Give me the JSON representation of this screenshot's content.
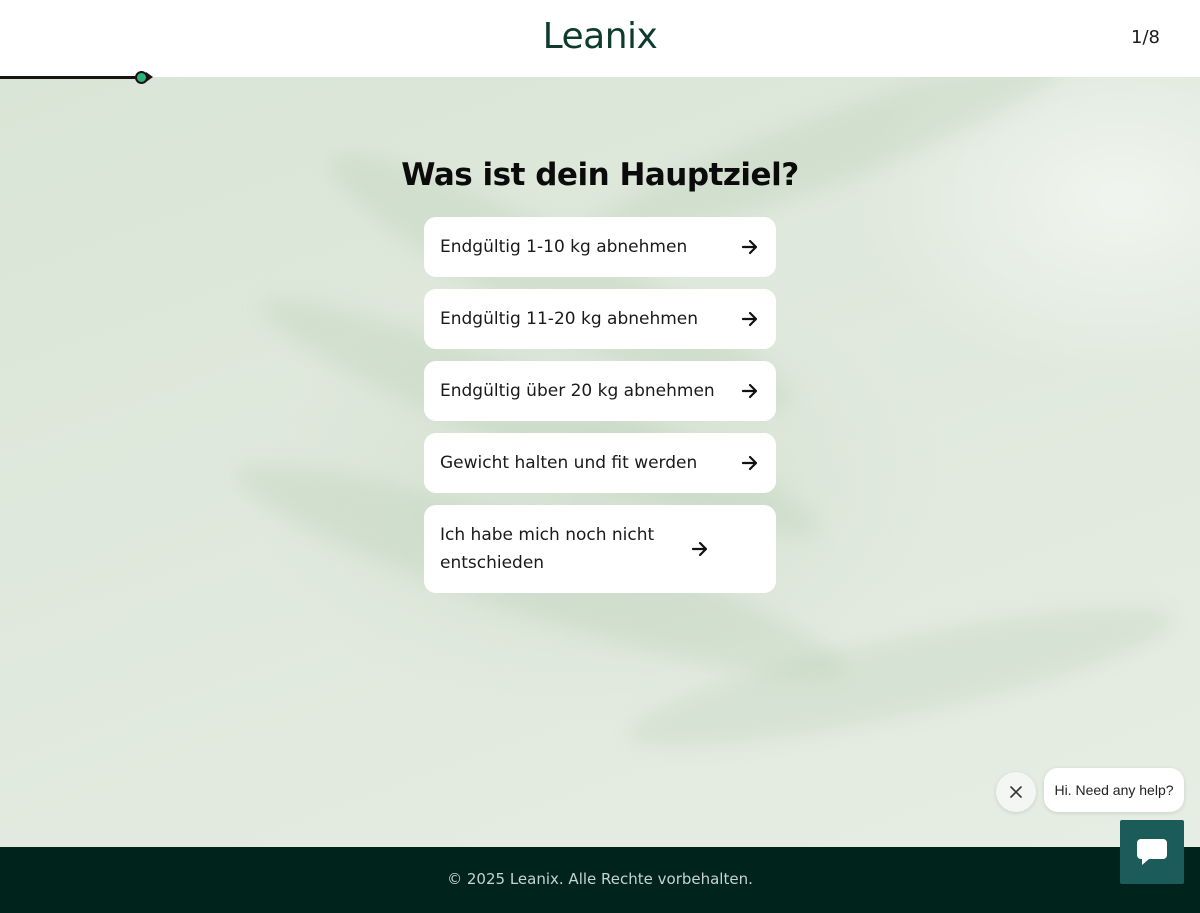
{
  "header": {
    "logo": "Leanix",
    "step": "1/8"
  },
  "progress": {
    "fraction": 0.125
  },
  "question": {
    "title": "Was ist dein Hauptziel?"
  },
  "options": [
    {
      "label": "Endgültig 1-10 kg abnehmen"
    },
    {
      "label": "Endgültig 11-20 kg abnehmen"
    },
    {
      "label": "Endgültig über 20 kg abnehmen"
    },
    {
      "label": "Gewicht halten und fit werden"
    },
    {
      "label": "Ich habe mich noch nicht entschieden"
    }
  ],
  "footer": {
    "copyright": "© 2025 Leanix. Alle Rechte vorbehalten."
  },
  "chat": {
    "greeting": "Hi. Need any help?"
  },
  "colors": {
    "brand": "#0f3b2e",
    "accent": "#2ab47a",
    "footer_bg": "#00231c",
    "chat_button": "#1b5c5a"
  },
  "icons": {
    "option_arrow": "arrow-right-icon",
    "chat_close": "close-icon",
    "chat_launcher": "chat-bubble-icon"
  }
}
